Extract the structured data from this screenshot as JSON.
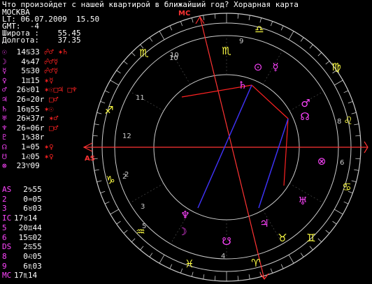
{
  "header": {
    "question": "Что произойдет с нашей квартирой в ближайший год? Хорарная карта",
    "city": "МОСКВА",
    "lt": "LT: 06.07.2009  15.50",
    "gmt": "GMT:  -4",
    "latitude": "Широта :    55.45",
    "longitude": "Долгота:    37.35"
  },
  "planets": [
    {
      "symbol": "☉",
      "position": " 14♋33",
      "aspects": " ☍♂ ✶♄"
    },
    {
      "symbol": "☽",
      "position": "  4♑47",
      "aspects": " ☍♂☿"
    },
    {
      "symbol": "☿",
      "position": "  5♋30",
      "aspects": " ☍♂☿"
    },
    {
      "symbol": "♀",
      "position": "  1♊15",
      "aspects": " ✶☿"
    },
    {
      "symbol": "♂",
      "position": " 26♉01",
      "aspects": " ✶☉□♃ □♆"
    },
    {
      "symbol": "♃",
      "position": " 26♒20r",
      "aspects": " □♂"
    },
    {
      "symbol": "♄",
      "position": " 16♍55",
      "aspects": " ✶☉"
    },
    {
      "symbol": "♅",
      "position": " 26♓37r",
      "aspects": " ✶♂"
    },
    {
      "symbol": "♆",
      "position": " 26♒06r",
      "aspects": " □♂"
    },
    {
      "symbol": "♇",
      "position": "  1♑38r",
      "aspects": ""
    },
    {
      "symbol": "☊",
      "position": "  1♒05",
      "aspects": " ✶♀"
    },
    {
      "symbol": "☋",
      "position": "  1♌05",
      "aspects": " ✶♀"
    },
    {
      "symbol": "⊗",
      "position": " 23♈09",
      "aspects": ""
    }
  ],
  "houses": [
    {
      "label": "AS",
      "position": "  2♑55"
    },
    {
      "label": "2",
      "position": "  0♒05"
    },
    {
      "label": "3",
      "position": "  6♉03"
    },
    {
      "label": "IC",
      "position": "17♉14"
    },
    {
      "label": "5",
      "position": " 20♊44"
    },
    {
      "label": "6",
      "position": " 15♋02"
    },
    {
      "label": "DS",
      "position": "  2♋55"
    },
    {
      "label": "8",
      "position": "  0♌05"
    },
    {
      "label": "9",
      "position": "  6♏03"
    },
    {
      "label": "MC",
      "position": "17♏14"
    }
  ],
  "chart": {
    "as_label": "AS",
    "mc_label": "MC",
    "house_numbers": [
      "1",
      "2",
      "3",
      "4",
      "5",
      "6",
      "7",
      "8",
      "9",
      "10",
      "11",
      "12"
    ],
    "zodiac_glyphs": [
      "♑",
      "♒",
      "♓",
      "♈",
      "♉",
      "♊",
      "♋",
      "♌",
      "♍",
      "♎",
      "♏",
      "♐"
    ],
    "planet_glyphs": [
      "⊙",
      "☿",
      "♄",
      "♂",
      "☊",
      "⊗",
      "♅",
      "♃",
      "♆",
      "☽",
      "♆",
      "☋"
    ],
    "colors": {
      "circles": "#cccccc",
      "axis": "#ff3333",
      "zodiac": "#ffff44",
      "planets": "#ff44ff",
      "aspect_square": "#ff2222",
      "aspect_trine": "#3333ff",
      "house_numbers": "#cccccc",
      "background": "#000000"
    }
  }
}
